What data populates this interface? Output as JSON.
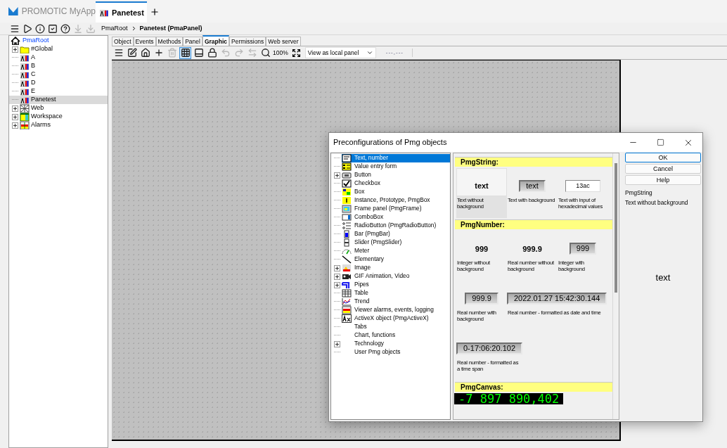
{
  "app": {
    "title": "PROMOTIC MyApp"
  },
  "doc_tabs": [
    {
      "label": "Panetest",
      "selected": true
    }
  ],
  "main_tools": [
    {
      "kind": "menu",
      "disabled": false
    },
    {
      "kind": "run",
      "disabled": false
    },
    {
      "kind": "info",
      "disabled": false
    },
    {
      "kind": "check",
      "disabled": false
    },
    {
      "kind": "help",
      "disabled": false
    },
    {
      "kind": "download-all",
      "disabled": true
    },
    {
      "kind": "download",
      "disabled": true
    }
  ],
  "breadcrumb": [
    "PmaRoot",
    "Panetest (PmaPanel)"
  ],
  "tree": {
    "label": "PmaRoot",
    "kind": "home",
    "children": [
      {
        "label": "#Global",
        "kind": "folder",
        "expandable": true,
        "selected": false
      },
      {
        "label": "A",
        "kind": "panel",
        "expandable": false,
        "selected": false
      },
      {
        "label": "B",
        "kind": "panel",
        "expandable": false,
        "selected": false
      },
      {
        "label": "C",
        "kind": "panel",
        "expandable": false,
        "selected": false
      },
      {
        "label": "D",
        "kind": "panel",
        "expandable": false,
        "selected": false
      },
      {
        "label": "E",
        "kind": "panel",
        "expandable": false,
        "selected": false
      },
      {
        "label": "Panetest",
        "kind": "panel",
        "expandable": false,
        "selected": true
      },
      {
        "label": "Web",
        "kind": "web",
        "expandable": true,
        "selected": false
      },
      {
        "label": "Workspace",
        "kind": "workspace",
        "expandable": true,
        "selected": false
      },
      {
        "label": "Alarms",
        "kind": "alarms",
        "expandable": true,
        "selected": false
      }
    ]
  },
  "editor_tabs": [
    {
      "label": "Object",
      "selected": false
    },
    {
      "label": "Events",
      "selected": false
    },
    {
      "label": "Methods",
      "selected": false
    },
    {
      "label": "Panel",
      "selected": false
    },
    {
      "label": "Graphic",
      "selected": true
    },
    {
      "label": "Permissions",
      "selected": false
    },
    {
      "label": "Web server",
      "selected": false
    }
  ],
  "editor_tools": [
    {
      "kind": "menu",
      "disabled": false,
      "selected": false
    },
    {
      "kind": "edit",
      "disabled": false,
      "selected": false
    },
    {
      "kind": "home",
      "disabled": false,
      "selected": false
    },
    {
      "kind": "add",
      "disabled": false,
      "selected": false
    },
    {
      "kind": "delete",
      "disabled": true,
      "selected": false
    },
    {
      "kind": "grid",
      "disabled": false,
      "selected": true
    },
    {
      "kind": "window",
      "disabled": false,
      "selected": false
    },
    {
      "kind": "lock",
      "disabled": false,
      "selected": false
    },
    {
      "kind": "undo",
      "disabled": true,
      "selected": false
    },
    {
      "kind": "redo",
      "disabled": true,
      "selected": false
    },
    {
      "kind": "swap",
      "disabled": true,
      "selected": false
    },
    {
      "kind": "zoom",
      "disabled": false,
      "selected": false
    }
  ],
  "zoom_level": "100%",
  "view_mode": "View as local panel",
  "coordinates": "---,---",
  "dialog": {
    "title": "Preconfigurations of Pmg objects",
    "tree": [
      {
        "label": "Text, number",
        "kind": "text",
        "expandable": false,
        "selected": true
      },
      {
        "label": "Value entry form",
        "kind": "form",
        "expandable": false,
        "selected": false
      },
      {
        "label": "Button",
        "kind": "button",
        "expandable": true,
        "selected": false
      },
      {
        "label": "Checkbox",
        "kind": "checkbox",
        "expandable": false,
        "selected": false
      },
      {
        "label": "Box",
        "kind": "box",
        "expandable": false,
        "selected": false
      },
      {
        "label": "Instance, Prototype, PmgBox",
        "kind": "instance",
        "expandable": false,
        "selected": false
      },
      {
        "label": "Frame panel (PmgFrame)",
        "kind": "frame",
        "expandable": false,
        "selected": false
      },
      {
        "label": "ComboBox",
        "kind": "combo",
        "expandable": false,
        "selected": false
      },
      {
        "label": "RadioButton (PmgRadioButton)",
        "kind": "radio",
        "expandable": false,
        "selected": false
      },
      {
        "label": "Bar (PmgBar)",
        "kind": "bar",
        "expandable": false,
        "selected": false
      },
      {
        "label": "Slider (PmgSlider)",
        "kind": "slider",
        "expandable": false,
        "selected": false
      },
      {
        "label": "Meter",
        "kind": "meter",
        "expandable": false,
        "selected": false
      },
      {
        "label": "Elementary",
        "kind": "line",
        "expandable": false,
        "selected": false
      },
      {
        "label": "Image",
        "kind": "image",
        "expandable": true,
        "selected": false
      },
      {
        "label": "GIF Animation, Video",
        "kind": "video",
        "expandable": true,
        "selected": false
      },
      {
        "label": "Pipes",
        "kind": "pipe",
        "expandable": true,
        "selected": false
      },
      {
        "label": "Table",
        "kind": "table",
        "expandable": false,
        "selected": false
      },
      {
        "label": "Trend",
        "kind": "trend",
        "expandable": false,
        "selected": false
      },
      {
        "label": "Viewer alarms, events, logging",
        "kind": "viewer",
        "expandable": false,
        "selected": false
      },
      {
        "label": "ActiveX object (PmgActiveX)",
        "kind": "activex",
        "expandable": false,
        "selected": false
      },
      {
        "label": "Tabs",
        "kind": "none",
        "expandable": false,
        "selected": false
      },
      {
        "label": "Chart, functions",
        "kind": "none",
        "expandable": false,
        "selected": false
      },
      {
        "label": "Technology",
        "kind": "none",
        "expandable": true,
        "selected": false
      },
      {
        "label": "User Pmg objects",
        "kind": "none",
        "expandable": false,
        "selected": false
      }
    ],
    "sections": [
      {
        "title": "PmgString:",
        "items": [
          {
            "kind": "plain",
            "value": "text",
            "label": "Text without background",
            "selected": true
          },
          {
            "kind": "raised",
            "value": "text",
            "label": "Text with background",
            "selected": false
          },
          {
            "kind": "input",
            "value": "13ac",
            "label": "Text with input of hexadecimal values",
            "selected": false
          }
        ]
      },
      {
        "title": "PmgNumber:",
        "items": [
          {
            "kind": "plain",
            "value": "999",
            "label": "Integer without background",
            "selected": false
          },
          {
            "kind": "plain",
            "value": "999.9",
            "label": "Real number without background",
            "selected": false
          },
          {
            "kind": "raised",
            "value": "999",
            "label": "Integer with background",
            "selected": false
          },
          {
            "kind": "raised",
            "value": "999.9",
            "label": "Real number with background",
            "selected": false
          },
          {
            "kind": "raised",
            "value": "2022.01.27 15:42:30.144",
            "label": "Real number - formatted as date and time",
            "selected": false
          },
          {
            "kind": "raised",
            "value": "0-17:06:20.102",
            "label": "Real number - formatted as a time span",
            "selected": false
          }
        ]
      },
      {
        "title": "PmgCanvas:",
        "items": [
          {
            "kind": "lcd",
            "value": "-7 897 890,402",
            "selected": false
          }
        ]
      }
    ],
    "buttons": [
      {
        "label": "OK",
        "default": true
      },
      {
        "label": "Cancel",
        "default": false
      },
      {
        "label": "Help",
        "default": false
      }
    ],
    "description": [
      "PmgString",
      "Text without background"
    ],
    "preview": "text"
  }
}
